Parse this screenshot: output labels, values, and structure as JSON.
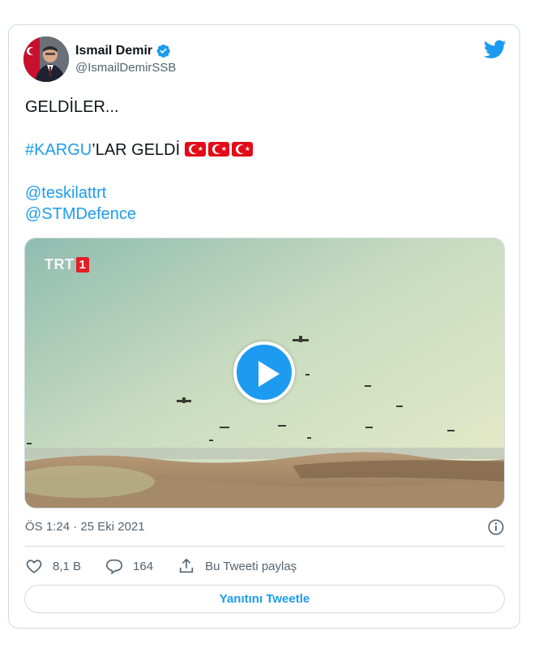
{
  "author": {
    "display_name": "Ismail Demir",
    "handle": "@IsmailDemirSSB"
  },
  "tweet": {
    "line1": "GELDİLER...",
    "hashtag": "#KARGU",
    "line2_rest": "’LAR GELDİ",
    "flag_count": 3,
    "mention1": "@teskilattrt",
    "mention2": "@STMDefence"
  },
  "media": {
    "channel_logo_text": "TRT",
    "channel_logo_number": "1",
    "type": "video"
  },
  "meta": {
    "timestamp": "ÖS 1:24 · 25 Eki 2021"
  },
  "actions": {
    "likes": "8,1 B",
    "replies": "164",
    "share_label": "Bu Tweeti paylaş"
  },
  "reply_button": {
    "label": "Yanıtını Tweetle"
  },
  "colors": {
    "accent": "#1d9bf0",
    "secondary_text": "#536471",
    "border": "#cfd9de",
    "flag_red": "#e30a17"
  },
  "icons": [
    "verified-badge-icon",
    "twitter-bird-icon",
    "play-icon",
    "info-icon",
    "heart-icon",
    "reply-icon",
    "share-icon"
  ]
}
